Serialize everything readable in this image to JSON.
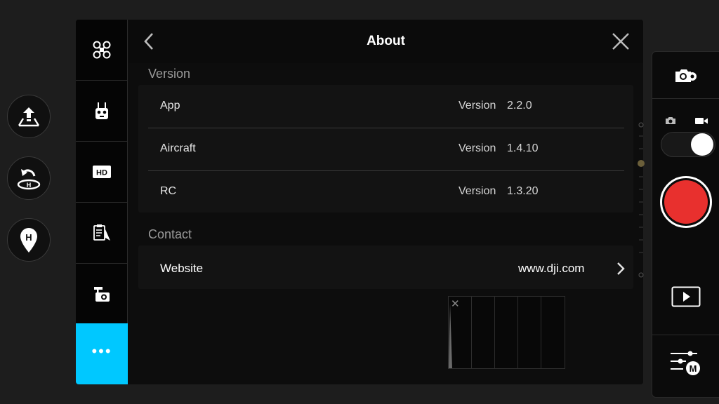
{
  "header": {
    "title": "About"
  },
  "left_controls": [
    {
      "icon": "takeoff-icon"
    },
    {
      "icon": "return-home-icon"
    },
    {
      "icon": "home-point-icon"
    }
  ],
  "sidenav": {
    "items": [
      {
        "icon": "aircraft-icon"
      },
      {
        "icon": "remote-controller-icon"
      },
      {
        "icon": "hd-icon",
        "label": "HD"
      },
      {
        "icon": "checklist-icon"
      },
      {
        "icon": "gimbal-camera-icon"
      },
      {
        "icon": "more-icon",
        "label": "•••",
        "active": true
      }
    ],
    "accent": "#00c8ff"
  },
  "version_section": {
    "label": "Version",
    "rows": [
      {
        "name": "App",
        "version_label": "Version",
        "version": "2.2.0"
      },
      {
        "name": "Aircraft",
        "version_label": "Version",
        "version": "1.4.10"
      },
      {
        "name": "RC",
        "version_label": "Version",
        "version": "1.3.20"
      }
    ]
  },
  "contact_section": {
    "label": "Contact",
    "website_label": "Website",
    "website_url": "www.dji.com"
  },
  "histogram": {
    "close_glyph": "✕"
  },
  "right_panel": {
    "icons": [
      "camera-settings-icon",
      "photo-mode-icon",
      "video-mode-icon",
      "playback-icon",
      "exposure-manual-icon"
    ],
    "manual_badge": "M",
    "record_color": "#e8302e"
  }
}
